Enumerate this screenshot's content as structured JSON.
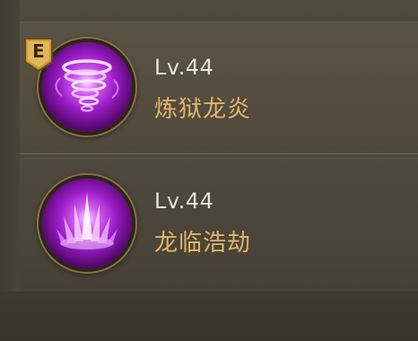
{
  "skills": [
    {
      "grade": "E",
      "level": "Lv.44",
      "name": "炼狱龙炎",
      "icon": "purple-vortex-icon"
    },
    {
      "level": "Lv.44",
      "name": "龙临浩劫",
      "icon": "purple-crystal-burst-icon"
    }
  ],
  "colors": {
    "panel_background": "#4a4438",
    "level_text": "#e9e4d8",
    "skill_name_text": "#e0b56a",
    "icon_glow": "#c040f0",
    "badge_gold": "#c99a3e"
  }
}
